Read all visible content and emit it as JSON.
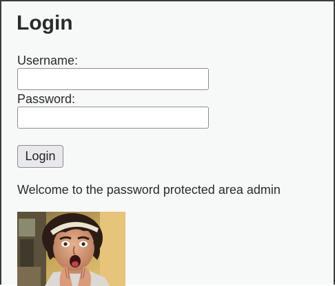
{
  "page": {
    "title": "Login"
  },
  "form": {
    "username_label": "Username:",
    "username_value": "",
    "password_label": "Password:",
    "password_value": "",
    "submit_label": "Login"
  },
  "message": {
    "welcome_text": "Welcome to the password protected area admin"
  },
  "image": {
    "description_icon": "user-photo"
  },
  "colors": {
    "background": "#f7f8f8",
    "text": "#2a2a2a",
    "button_bg": "#e9e9ed",
    "border": "#8d8d8d"
  }
}
